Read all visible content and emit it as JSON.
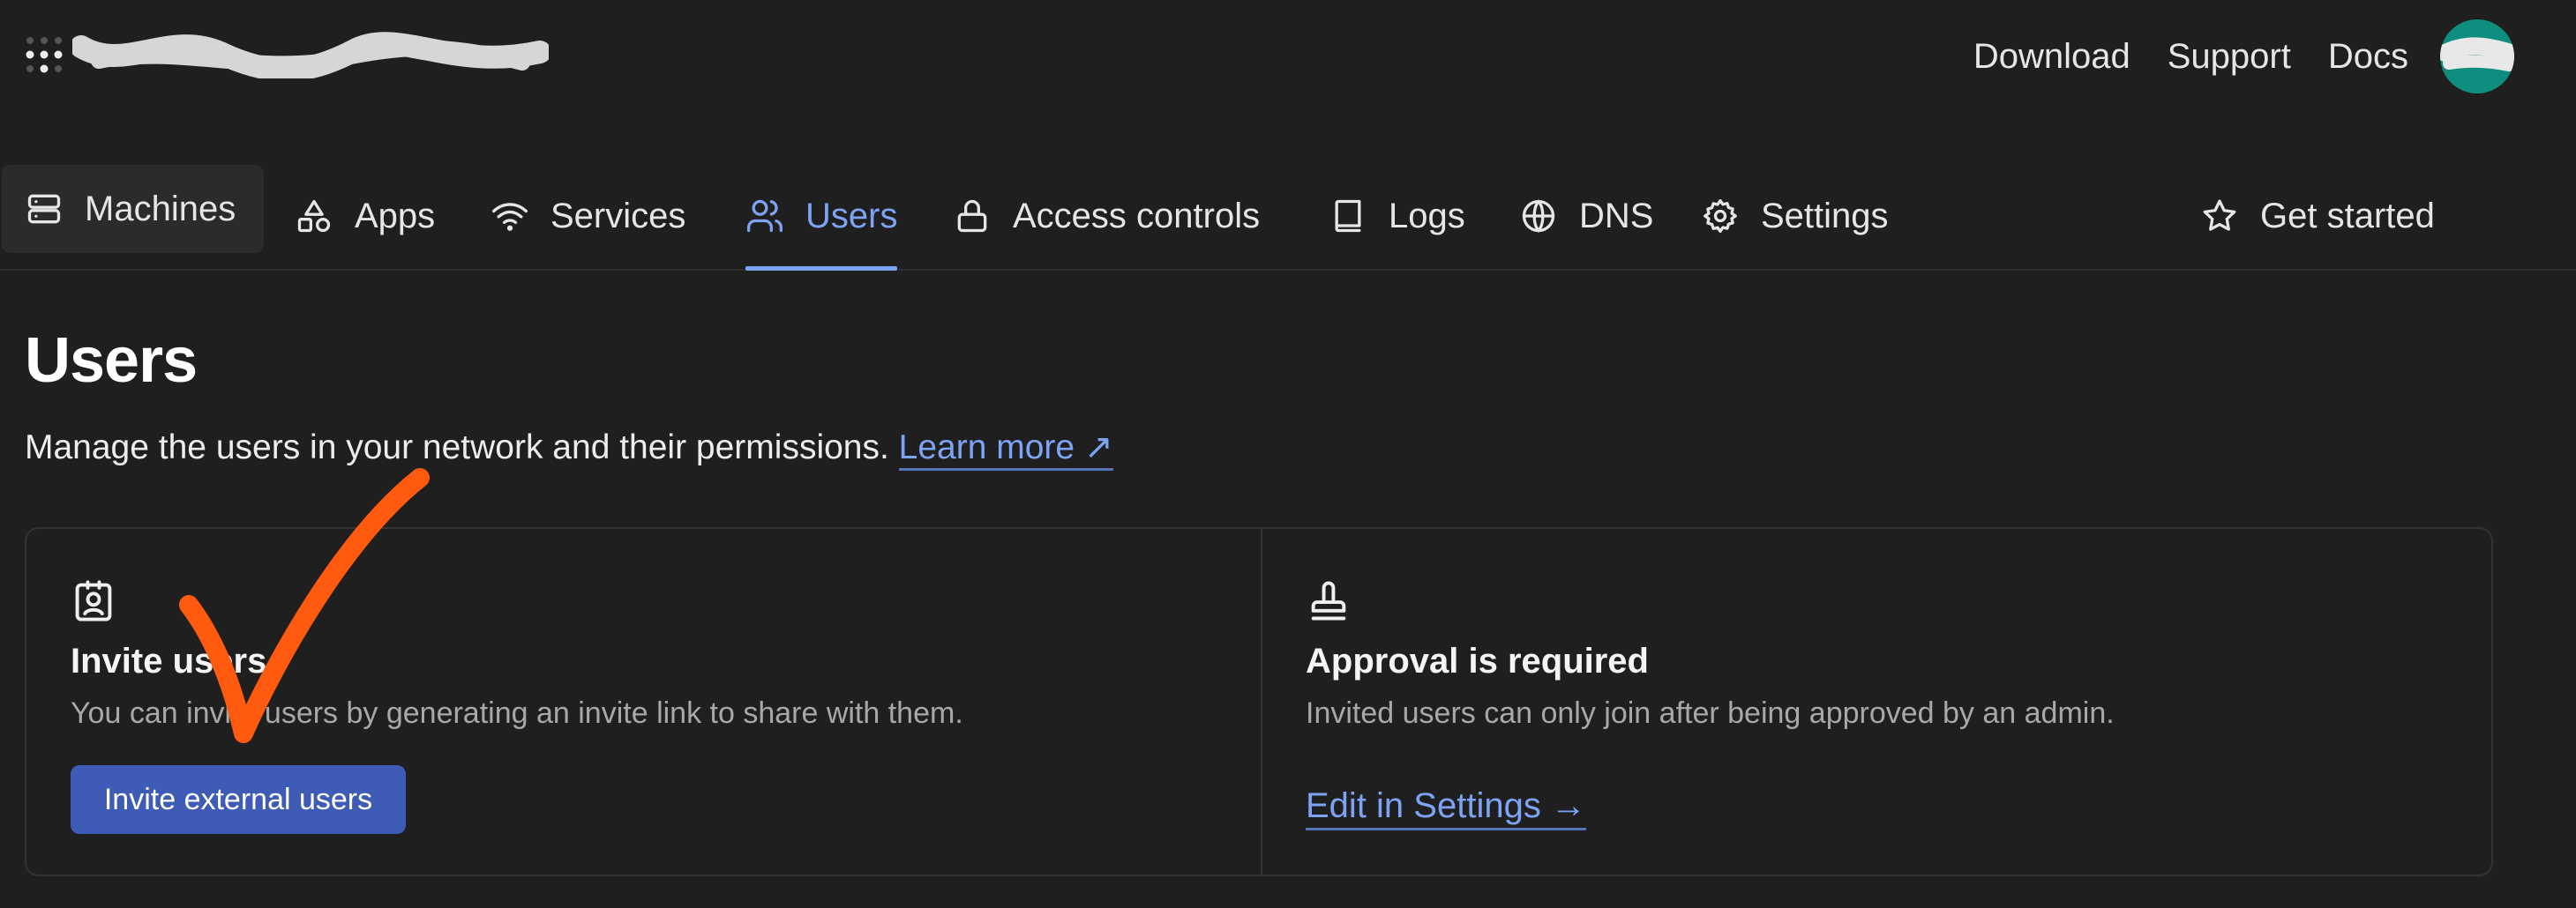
{
  "topbar": {
    "links": {
      "download": "Download",
      "support": "Support",
      "docs": "Docs"
    }
  },
  "tabs": {
    "machines": "Machines",
    "apps": "Apps",
    "services": "Services",
    "users": "Users",
    "access_controls": "Access controls",
    "logs": "Logs",
    "dns": "DNS",
    "settings": "Settings",
    "get_started": "Get started"
  },
  "page": {
    "title": "Users",
    "description": "Manage the users in your network and their permissions.",
    "learn_more": "Learn more ↗"
  },
  "invite": {
    "title": "Invite users",
    "description": "You can invite users by generating an invite link to share with them.",
    "button": "Invite external users"
  },
  "approval": {
    "title": "Approval is required",
    "description": "Invited users can only join after being approved by an admin.",
    "link": "Edit in Settings →"
  },
  "colors": {
    "background": "#1f1f1f",
    "accent": "#7da3f5",
    "button": "#3e5bb6",
    "avatar": "#0f8e80",
    "annotation": "#ff5a0f"
  }
}
